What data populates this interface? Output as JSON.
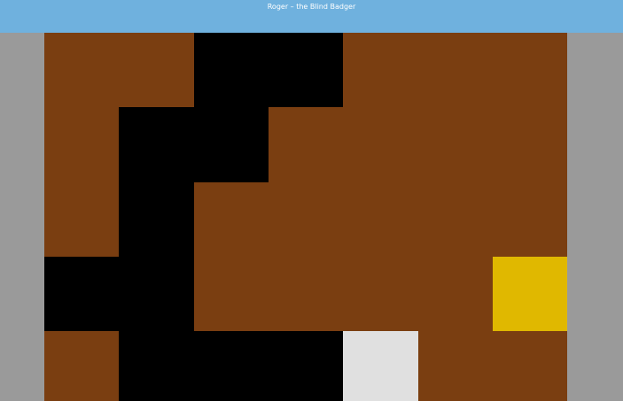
{
  "window": {
    "title": "Roger – the Blind Badger"
  },
  "colors": {
    "titlebar": "#6fb1de",
    "background": "#9a9a9a",
    "dirt": "#7a3e11",
    "tunnel": "#000000",
    "honey": "#e0b800",
    "badger": "#e0e0e0"
  },
  "grid": {
    "columns": 7,
    "rows": 5,
    "legend": {
      "D": "dirt",
      "T": "tunnel",
      "Y": "honey",
      "B": "badger"
    },
    "cells": [
      [
        "D",
        "D",
        "T",
        "T",
        "D",
        "D",
        "D"
      ],
      [
        "D",
        "T",
        "T",
        "D",
        "D",
        "D",
        "D"
      ],
      [
        "D",
        "T",
        "D",
        "D",
        "D",
        "D",
        "D"
      ],
      [
        "T",
        "T",
        "D",
        "D",
        "D",
        "D",
        "Y"
      ],
      [
        "D",
        "T",
        "T",
        "T",
        "B",
        "D",
        "D"
      ]
    ]
  }
}
